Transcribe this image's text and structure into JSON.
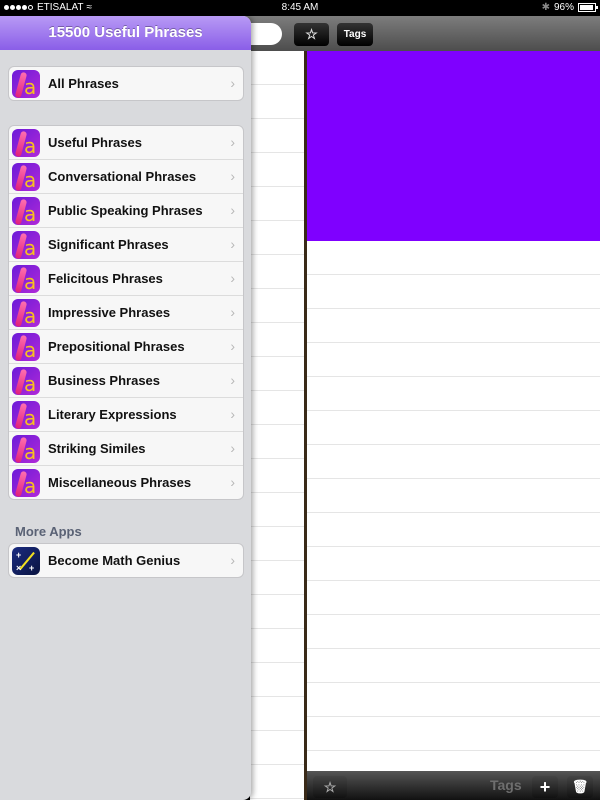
{
  "status_bar": {
    "carrier": "ETISALAT",
    "time": "8:45 AM",
    "battery": "96%",
    "battery_level": 0.96
  },
  "toolbar": {
    "search_placeholder": "",
    "favorites_icon": "star-outline",
    "tags_label": "Tags"
  },
  "popover": {
    "title": "15500 Useful Phrases",
    "all_group": [
      {
        "label": "All Phrases",
        "icon": "phrases-app-icon"
      }
    ],
    "categories": [
      {
        "label": "Useful Phrases",
        "icon": "phrases-app-icon"
      },
      {
        "label": "Conversational Phrases",
        "icon": "phrases-app-icon"
      },
      {
        "label": "Public Speaking Phrases",
        "icon": "phrases-app-icon"
      },
      {
        "label": "Significant Phrases",
        "icon": "phrases-app-icon"
      },
      {
        "label": "Felicitous Phrases",
        "icon": "phrases-app-icon"
      },
      {
        "label": "Impressive Phrases",
        "icon": "phrases-app-icon"
      },
      {
        "label": "Prepositional Phrases",
        "icon": "phrases-app-icon"
      },
      {
        "label": "Business Phrases",
        "icon": "phrases-app-icon"
      },
      {
        "label": "Literary Expressions",
        "icon": "phrases-app-icon"
      },
      {
        "label": "Striking Similes",
        "icon": "phrases-app-icon"
      },
      {
        "label": "Miscellaneous Phrases",
        "icon": "phrases-app-icon"
      }
    ],
    "more_apps_label": "More Apps",
    "more_apps": [
      {
        "label": "Become Math Genius",
        "icon": "math-genius-app-icon"
      }
    ],
    "chevron": "›"
  },
  "detail": {
    "color_block": "#7f00ff"
  },
  "bottom_bar": {
    "favorite_icon": "star-outline",
    "tags_label": "Tags",
    "add_label": "+",
    "delete_icon": "trash"
  },
  "colors": {
    "header_purple": "#9b72ef",
    "accent_purple": "#7f00ff"
  }
}
